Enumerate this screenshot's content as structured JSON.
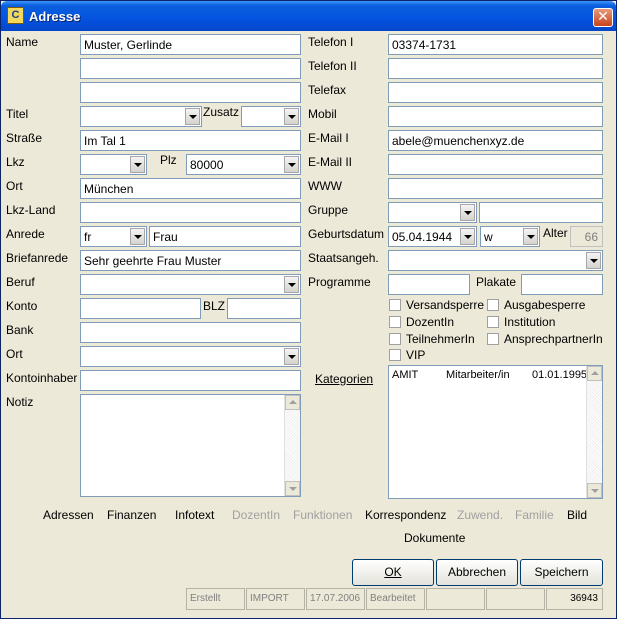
{
  "window": {
    "title": "Adresse",
    "icon": "app-icon",
    "close": "✕"
  },
  "left": {
    "name_label": "Name",
    "name1": "Muster, Gerlinde",
    "name2": "",
    "name3": "",
    "titel_label": "Titel",
    "titel_value": "",
    "zusatz_label": "Zusatz",
    "zusatz_value": "",
    "strasse_label": "Straße",
    "strasse_value": "Im Tal 1",
    "lkz_label": "Lkz",
    "lkz_value": "",
    "plz_label": "Plz",
    "plz_value": "80000",
    "ort_label": "Ort",
    "ort_value": "München",
    "lkzland_label": "Lkz-Land",
    "lkzland_value": "",
    "anrede_label": "Anrede",
    "anrede_short": "fr",
    "anrede_value": "Frau",
    "briefanrede_label": "Briefanrede",
    "briefanrede_value": "Sehr geehrte Frau Muster",
    "beruf_label": "Beruf",
    "beruf_value": "",
    "konto_label": "Konto",
    "konto_value": "",
    "blz_label": "BLZ",
    "blz_value": "",
    "bank_label": "Bank",
    "bank_value": "",
    "ort2_label": "Ort",
    "ort2_value": "",
    "kontoinhaber_label": "Kontoinhaber",
    "kontoinhaber_value": "",
    "notiz_label": "Notiz"
  },
  "right": {
    "telefon1_label": "Telefon I",
    "telefon1_value": "03374-1731",
    "telefon2_label": "Telefon II",
    "telefon2_value": "",
    "telefax_label": "Telefax",
    "telefax_value": "",
    "mobil_label": "Mobil",
    "mobil_value": "",
    "email1_label": "E-Mail I",
    "email1_value": "abele@muenchenxyz.de",
    "email2_label": "E-Mail II",
    "email2_value": "",
    "www_label": "WWW",
    "www_value": "",
    "gruppe_label": "Gruppe",
    "gruppe_value": "",
    "gruppe_text": "",
    "geburtsdatum_label": "Geburtsdatum",
    "geburtsdatum_value": "05.04.1944",
    "geschlecht_value": "w",
    "alter_label": "Alter",
    "alter_value": "66",
    "staatsangeh_label": "Staatsangeh.",
    "staatsangeh_value": "",
    "programme_label": "Programme",
    "programme_value": "",
    "plakate_label": "Plakate",
    "plakate_value": "",
    "checkboxes": [
      "Versandsperre",
      "Ausgabesperre",
      "DozentIn",
      "Institution",
      "TeilnehmerIn",
      "AnsprechpartnerIn",
      "VIP"
    ],
    "kategorien_label": "Kategorien",
    "kategorien": [
      {
        "code": "AMIT",
        "name": "Mitarbeiter/in",
        "date": "01.01.1995"
      }
    ]
  },
  "tabs": [
    "Adressen",
    "Finanzen",
    "Infotext",
    "DozentIn",
    "Funktionen",
    "Korrespondenz",
    "Zuwend.",
    "Familie",
    "Bild",
    "Dokumente"
  ],
  "buttons": {
    "ok": "OK",
    "abbrechen": "Abbrechen",
    "speichern": "Speichern"
  },
  "status": {
    "erstellt_label": "Erstellt",
    "erstellt_by": "IMPORT",
    "erstellt_date": "17.07.2006",
    "bearbeitet_label": "Bearbeitet",
    "bearbeitet_by": "",
    "bearbeitet_date": "",
    "id": "36943"
  },
  "colors": {
    "titlebar": "#0553e0",
    "window_bg": "#ece9d8",
    "disabled_text": "#a0a0a0"
  }
}
